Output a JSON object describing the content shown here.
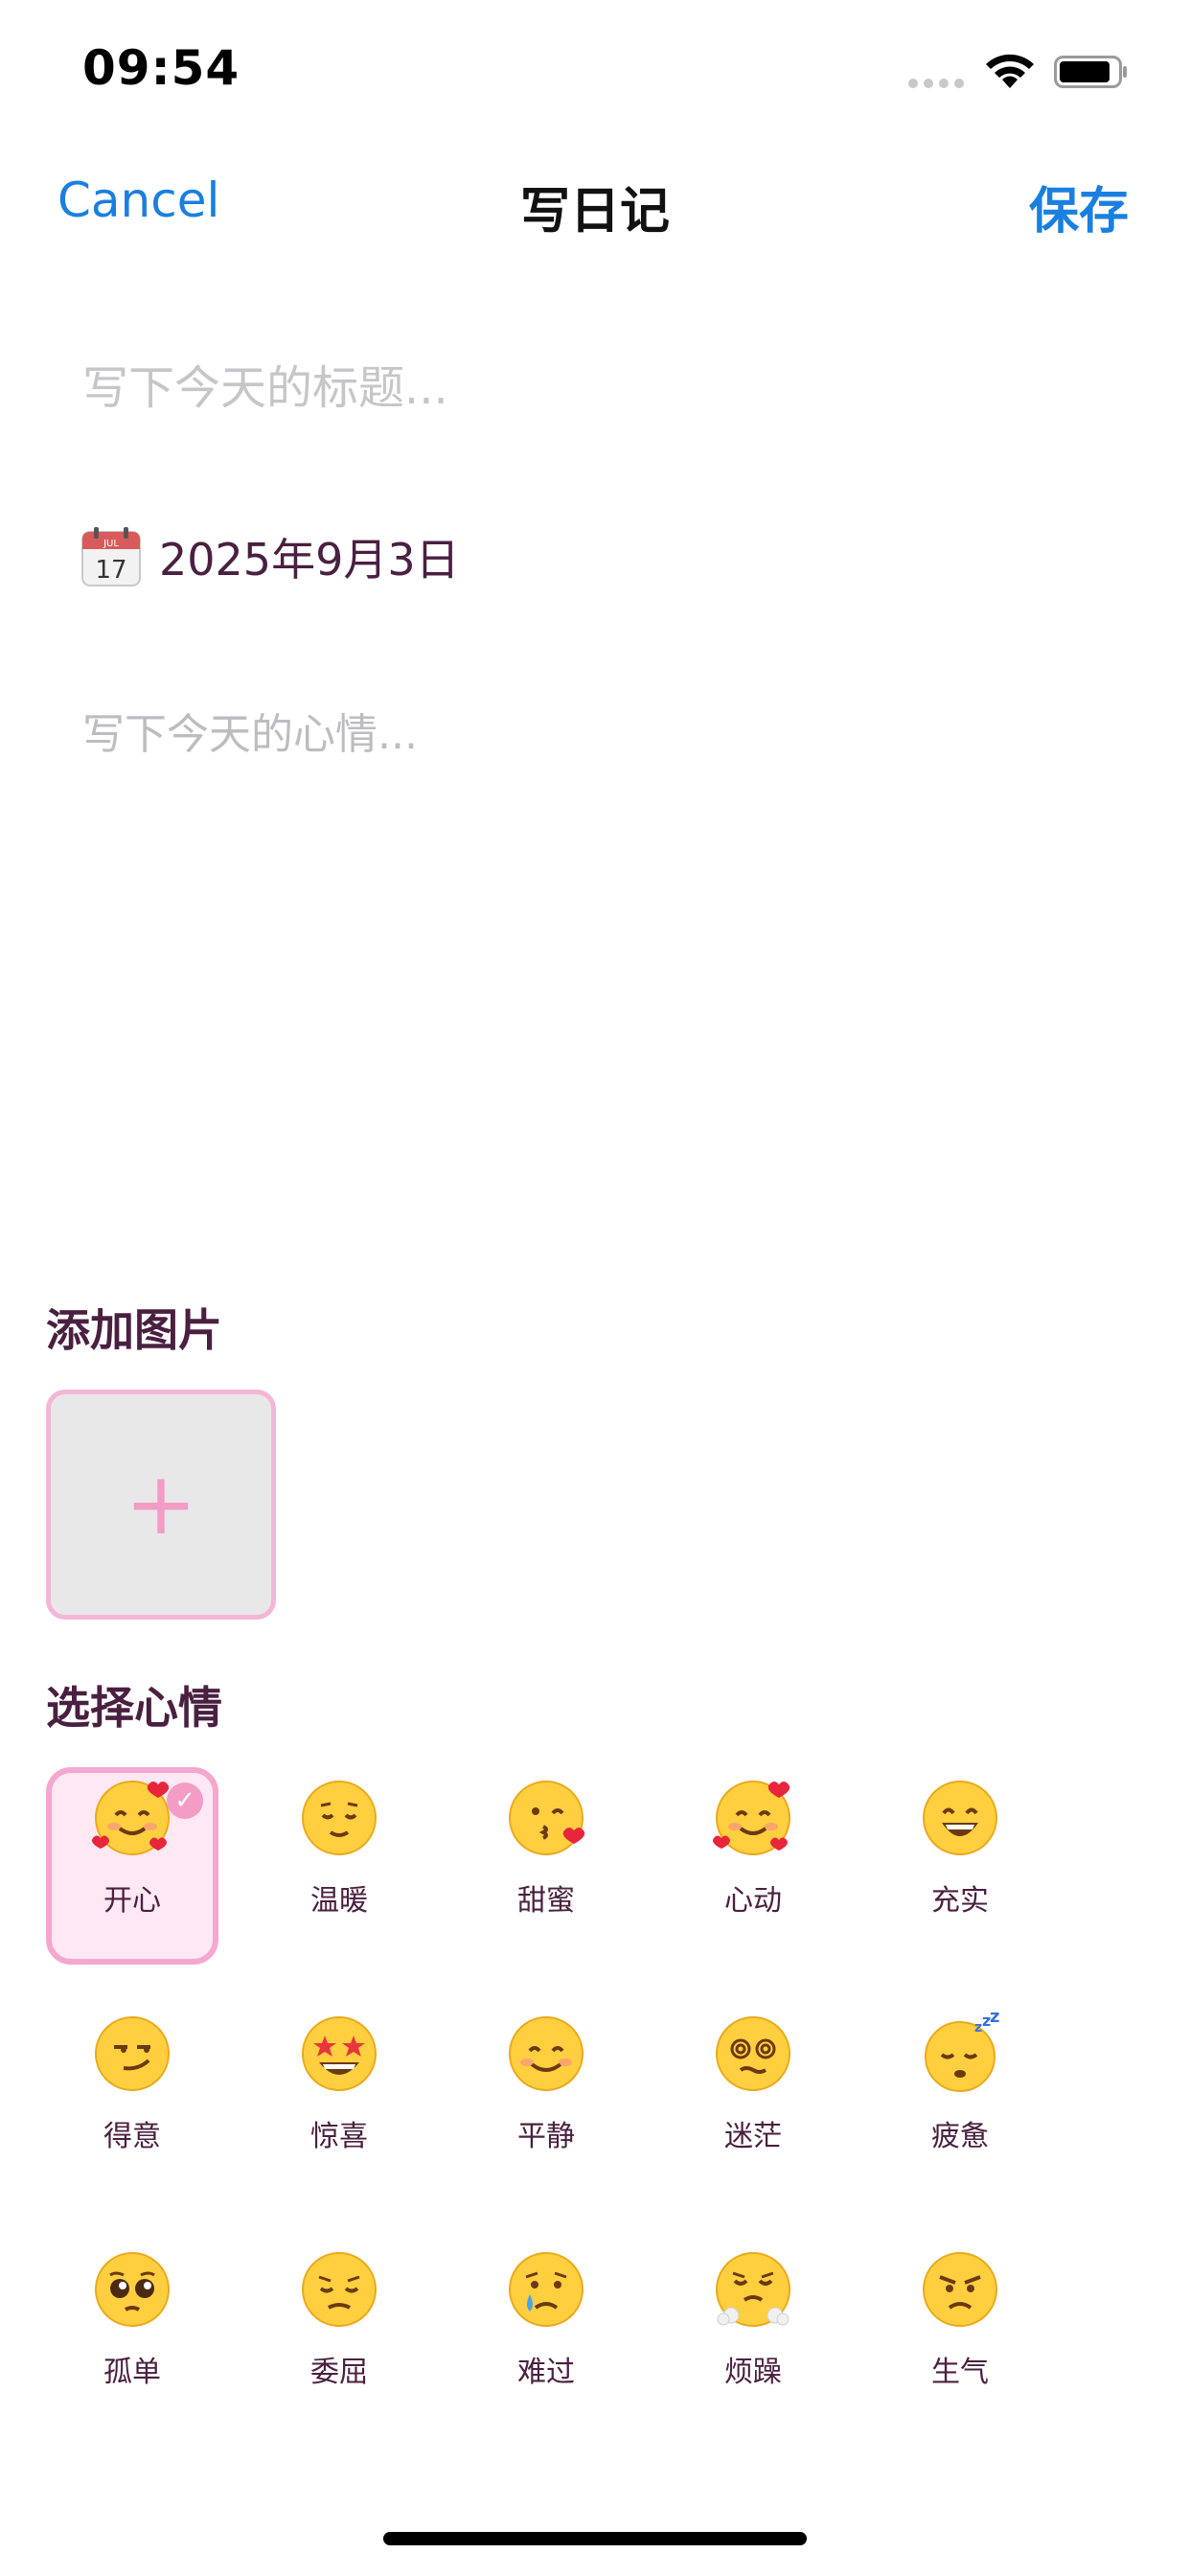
{
  "status_bar": {
    "time": "09:54"
  },
  "nav": {
    "cancel": "Cancel",
    "title": "写日记",
    "save": "保存"
  },
  "title_field": {
    "placeholder": "写下今天的标题..."
  },
  "date": {
    "text": "2025年9月3日",
    "calendar_month": "JUL",
    "calendar_day": "17"
  },
  "content_field": {
    "placeholder": "写下今天的心情..."
  },
  "photo_section": {
    "label": "添加图片",
    "add_symbol": "+"
  },
  "mood_section": {
    "label": "选择心情",
    "selected": "开心",
    "check_mark": "✓",
    "moods": [
      {
        "label": "开心",
        "icon": "smiling-face-with-hearts-icon"
      },
      {
        "label": "温暖",
        "icon": "relieved-face-icon"
      },
      {
        "label": "甜蜜",
        "icon": "face-blowing-kiss-icon"
      },
      {
        "label": "心动",
        "icon": "smiling-face-with-hearts-icon"
      },
      {
        "label": "充实",
        "icon": "grinning-face-icon"
      },
      {
        "label": "得意",
        "icon": "smirking-face-icon"
      },
      {
        "label": "惊喜",
        "icon": "star-struck-icon"
      },
      {
        "label": "平静",
        "icon": "smiling-face-icon"
      },
      {
        "label": "迷茫",
        "icon": "dizzy-face-icon"
      },
      {
        "label": "疲惫",
        "icon": "sleeping-face-icon"
      },
      {
        "label": "孤单",
        "icon": "pleading-face-icon"
      },
      {
        "label": "委屈",
        "icon": "pensive-face-icon"
      },
      {
        "label": "难过",
        "icon": "crying-face-icon"
      },
      {
        "label": "烦躁",
        "icon": "face-with-steam-icon"
      },
      {
        "label": "生气",
        "icon": "angry-face-icon"
      }
    ]
  },
  "colors": {
    "accent_blue": "#1a7fe0",
    "text_purple": "#4a2040",
    "pink": "#f4a7cf",
    "pink_fill": "#fde8f3"
  }
}
